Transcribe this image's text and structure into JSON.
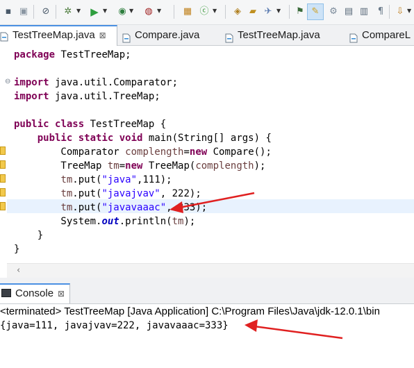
{
  "colors": {
    "keyword": "#7f0055",
    "string": "#2a00ff",
    "field": "#0000c0",
    "local_var": "#6a3e3e",
    "annotation_arrow": "#e02020",
    "tab_accent": "#4a90e2",
    "current_line": "#e8f2fe"
  },
  "toolbar": {
    "icons": [
      "save-icon",
      "save-all-icon",
      "skip-breakpoints-icon",
      "debug-icon",
      "run-icon",
      "coverage-icon",
      "external-tools-icon",
      "new-java-project-icon",
      "new-class-icon",
      "open-type-icon",
      "search-icon",
      "toggle-mark-occurrences-icon",
      "toggle-block-selection-icon",
      "show-whitespace-icon",
      "show-paragraph-icon",
      "next-annotation-icon"
    ]
  },
  "tabs": [
    {
      "label": "TestTreeMap.java",
      "active": true,
      "closable": true
    },
    {
      "label": "Compare.java",
      "active": false
    },
    {
      "label": "TestTreeMap.java",
      "active": false
    },
    {
      "label": "CompareL",
      "active": false
    }
  ],
  "editor": {
    "code_lines": [
      [
        {
          "t": "package",
          "c": "kw"
        },
        {
          "t": " TestTreeMap;",
          "c": "ty"
        }
      ],
      [],
      [
        {
          "t": "import",
          "c": "kw"
        },
        {
          "t": " java.util.Comparator;",
          "c": "ty"
        }
      ],
      [
        {
          "t": "import",
          "c": "kw"
        },
        {
          "t": " java.util.TreeMap;",
          "c": "ty"
        }
      ],
      [],
      [
        {
          "t": "public",
          "c": "kw"
        },
        {
          "t": " ",
          "c": "ty"
        },
        {
          "t": "class",
          "c": "kw"
        },
        {
          "t": " TestTreeMap {",
          "c": "ty"
        }
      ],
      [
        {
          "t": "    ",
          "c": "ty"
        },
        {
          "t": "public",
          "c": "kw"
        },
        {
          "t": " ",
          "c": "ty"
        },
        {
          "t": "static",
          "c": "kw"
        },
        {
          "t": " ",
          "c": "ty"
        },
        {
          "t": "void",
          "c": "kw"
        },
        {
          "t": " main(String[] args) {",
          "c": "ty"
        }
      ],
      [
        {
          "t": "        Comparator ",
          "c": "ty"
        },
        {
          "t": "complength",
          "c": "var"
        },
        {
          "t": "=",
          "c": "ty"
        },
        {
          "t": "new",
          "c": "kw"
        },
        {
          "t": " Compare();",
          "c": "ty"
        }
      ],
      [
        {
          "t": "        TreeMap ",
          "c": "ty"
        },
        {
          "t": "tm",
          "c": "var"
        },
        {
          "t": "=",
          "c": "ty"
        },
        {
          "t": "new",
          "c": "kw"
        },
        {
          "t": " TreeMap(",
          "c": "ty"
        },
        {
          "t": "complength",
          "c": "var"
        },
        {
          "t": ");",
          "c": "ty"
        }
      ],
      [
        {
          "t": "        ",
          "c": "ty"
        },
        {
          "t": "tm",
          "c": "var"
        },
        {
          "t": ".put(",
          "c": "ty"
        },
        {
          "t": "\"java\"",
          "c": "str"
        },
        {
          "t": ",111);",
          "c": "ty"
        }
      ],
      [
        {
          "t": "        ",
          "c": "ty"
        },
        {
          "t": "tm",
          "c": "var"
        },
        {
          "t": ".put(",
          "c": "ty"
        },
        {
          "t": "\"javajvav\"",
          "c": "str"
        },
        {
          "t": ", 222);",
          "c": "ty"
        }
      ],
      [
        {
          "t": "        ",
          "c": "ty"
        },
        {
          "t": "tm",
          "c": "var"
        },
        {
          "t": ".put(",
          "c": "ty"
        },
        {
          "t": "\"javavaaac\"",
          "c": "str"
        },
        {
          "t": ", 333);",
          "c": "ty"
        }
      ],
      [
        {
          "t": "        System.",
          "c": "ty"
        },
        {
          "t": "out",
          "c": "fld"
        },
        {
          "t": ".println(",
          "c": "ty"
        },
        {
          "t": "tm",
          "c": "var"
        },
        {
          "t": ");",
          "c": "ty"
        }
      ],
      [
        {
          "t": "    }",
          "c": "ty"
        }
      ],
      [
        {
          "t": "}",
          "c": "ty"
        }
      ]
    ]
  },
  "console": {
    "tab_label": "Console",
    "status": "<terminated> TestTreeMap [Java Application] C:\\Program Files\\Java\\jdk-12.0.1\\bin",
    "output": "{java=111, javajvav=222, javavaaac=333}"
  }
}
